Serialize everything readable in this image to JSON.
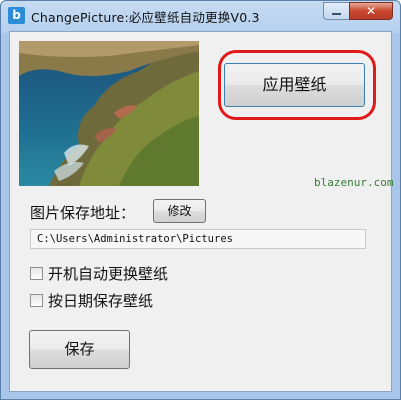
{
  "window": {
    "title": "ChangePicture:必应壁纸自动更换V0.3",
    "app_icon_glyph": "b",
    "minimize_icon": "minimize-icon",
    "close_glyph": "✕"
  },
  "main": {
    "apply_button_label": "应用壁纸",
    "watermark": "blazenur.com",
    "path_label": "图片保存地址：",
    "modify_button_label": "修改",
    "path_value": "C:\\Users\\Administrator\\Pictures",
    "options": [
      {
        "label": "开机自动更换壁纸",
        "checked": false
      },
      {
        "label": "按日期保存壁纸",
        "checked": false
      }
    ],
    "save_button_label": "保存",
    "highlight_color": "#e01a1a",
    "accent_blue": "#2b8cd8"
  }
}
